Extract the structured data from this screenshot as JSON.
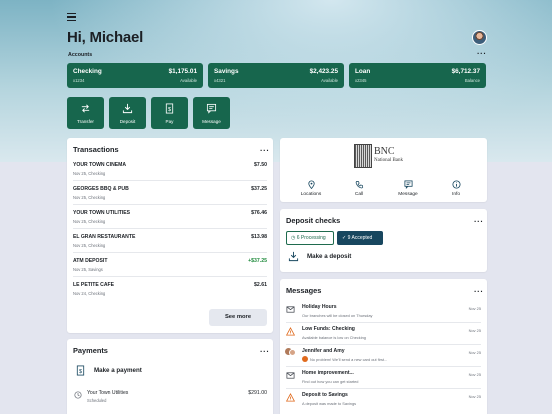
{
  "header": {
    "greeting": "Hi, Michael",
    "accounts_label": "Accounts"
  },
  "accounts": [
    {
      "name": "Checking",
      "number": "x1234",
      "balance": "$1,175.01",
      "kind": "Available"
    },
    {
      "name": "Savings",
      "number": "x4321",
      "balance": "$2,423.25",
      "kind": "Available"
    },
    {
      "name": "Loan",
      "number": "x2345",
      "balance": "$6,712.37",
      "kind": "Balance"
    }
  ],
  "actions": [
    {
      "label": "Transfer",
      "icon": "transfer-icon"
    },
    {
      "label": "Deposit",
      "icon": "deposit-icon"
    },
    {
      "label": "Pay",
      "icon": "pay-icon"
    },
    {
      "label": "Message",
      "icon": "message-icon"
    }
  ],
  "transactions": {
    "title": "Transactions",
    "items": [
      {
        "name": "YOUR TOWN CINEMA",
        "sub": "Nov 25, Checking",
        "amount": "$7.50"
      },
      {
        "name": "GEORGES BBQ & PUB",
        "sub": "Nov 25, Checking",
        "amount": "$37.25"
      },
      {
        "name": "YOUR TOWN UTILITIES",
        "sub": "Nov 25, Checking",
        "amount": "$76.46"
      },
      {
        "name": "EL GRAN RESTAURANTE",
        "sub": "Nov 25, Checking",
        "amount": "$13.98"
      },
      {
        "name": "ATM DEPOSIT",
        "sub": "Nov 25, Savings",
        "amount": "+$37.25"
      },
      {
        "name": "LE PETITE CAFE",
        "sub": "Nov 24, Checking",
        "amount": "$2.61"
      }
    ],
    "see_more": "See more"
  },
  "payments": {
    "title": "Payments",
    "make_payment": "Make a payment",
    "items": [
      {
        "name": "Your Town Utilities",
        "sub": "Scheduled",
        "amount": "$291.00"
      }
    ]
  },
  "bank": {
    "logo_text": "BNC",
    "logo_subtext": "National Bank",
    "quick_actions": [
      {
        "label": "Locations",
        "icon": "location-pin-icon"
      },
      {
        "label": "Call",
        "icon": "phone-icon"
      },
      {
        "label": "Message",
        "icon": "chat-icon"
      },
      {
        "label": "Info",
        "icon": "info-icon"
      }
    ]
  },
  "deposit_checks": {
    "title": "Deposit checks",
    "processing": "6 Processing",
    "accepted": "9 Accepted",
    "make_deposit": "Make a deposit"
  },
  "messages": {
    "title": "Messages",
    "items": [
      {
        "title": "Holiday Hours",
        "sub": "Our branches will be closed on Thursday",
        "date": "Nov 25",
        "icon": "envelope-icon"
      },
      {
        "title": "Low Funds: Checking",
        "sub": "Available balance is low on Checking",
        "date": "Nov 25",
        "icon": "warning-icon"
      },
      {
        "title": "Jennifer and Amy",
        "sub": "No problem! We'll send a new card out first...",
        "date": "Nov 25",
        "icon": "group-avatar-icon"
      },
      {
        "title": "Home improvement...",
        "sub": "Find out how you can get started",
        "date": "Nov 25",
        "icon": "envelope-icon"
      },
      {
        "title": "Deposit to Savings",
        "sub": "A deposit was made to Savings",
        "date": "Nov 25",
        "icon": "warning-icon"
      }
    ]
  },
  "colors": {
    "brand_green": "#17664d",
    "accepted_blue": "#18475f",
    "positive": "#1f8a3c",
    "warning": "#e06a1d"
  }
}
